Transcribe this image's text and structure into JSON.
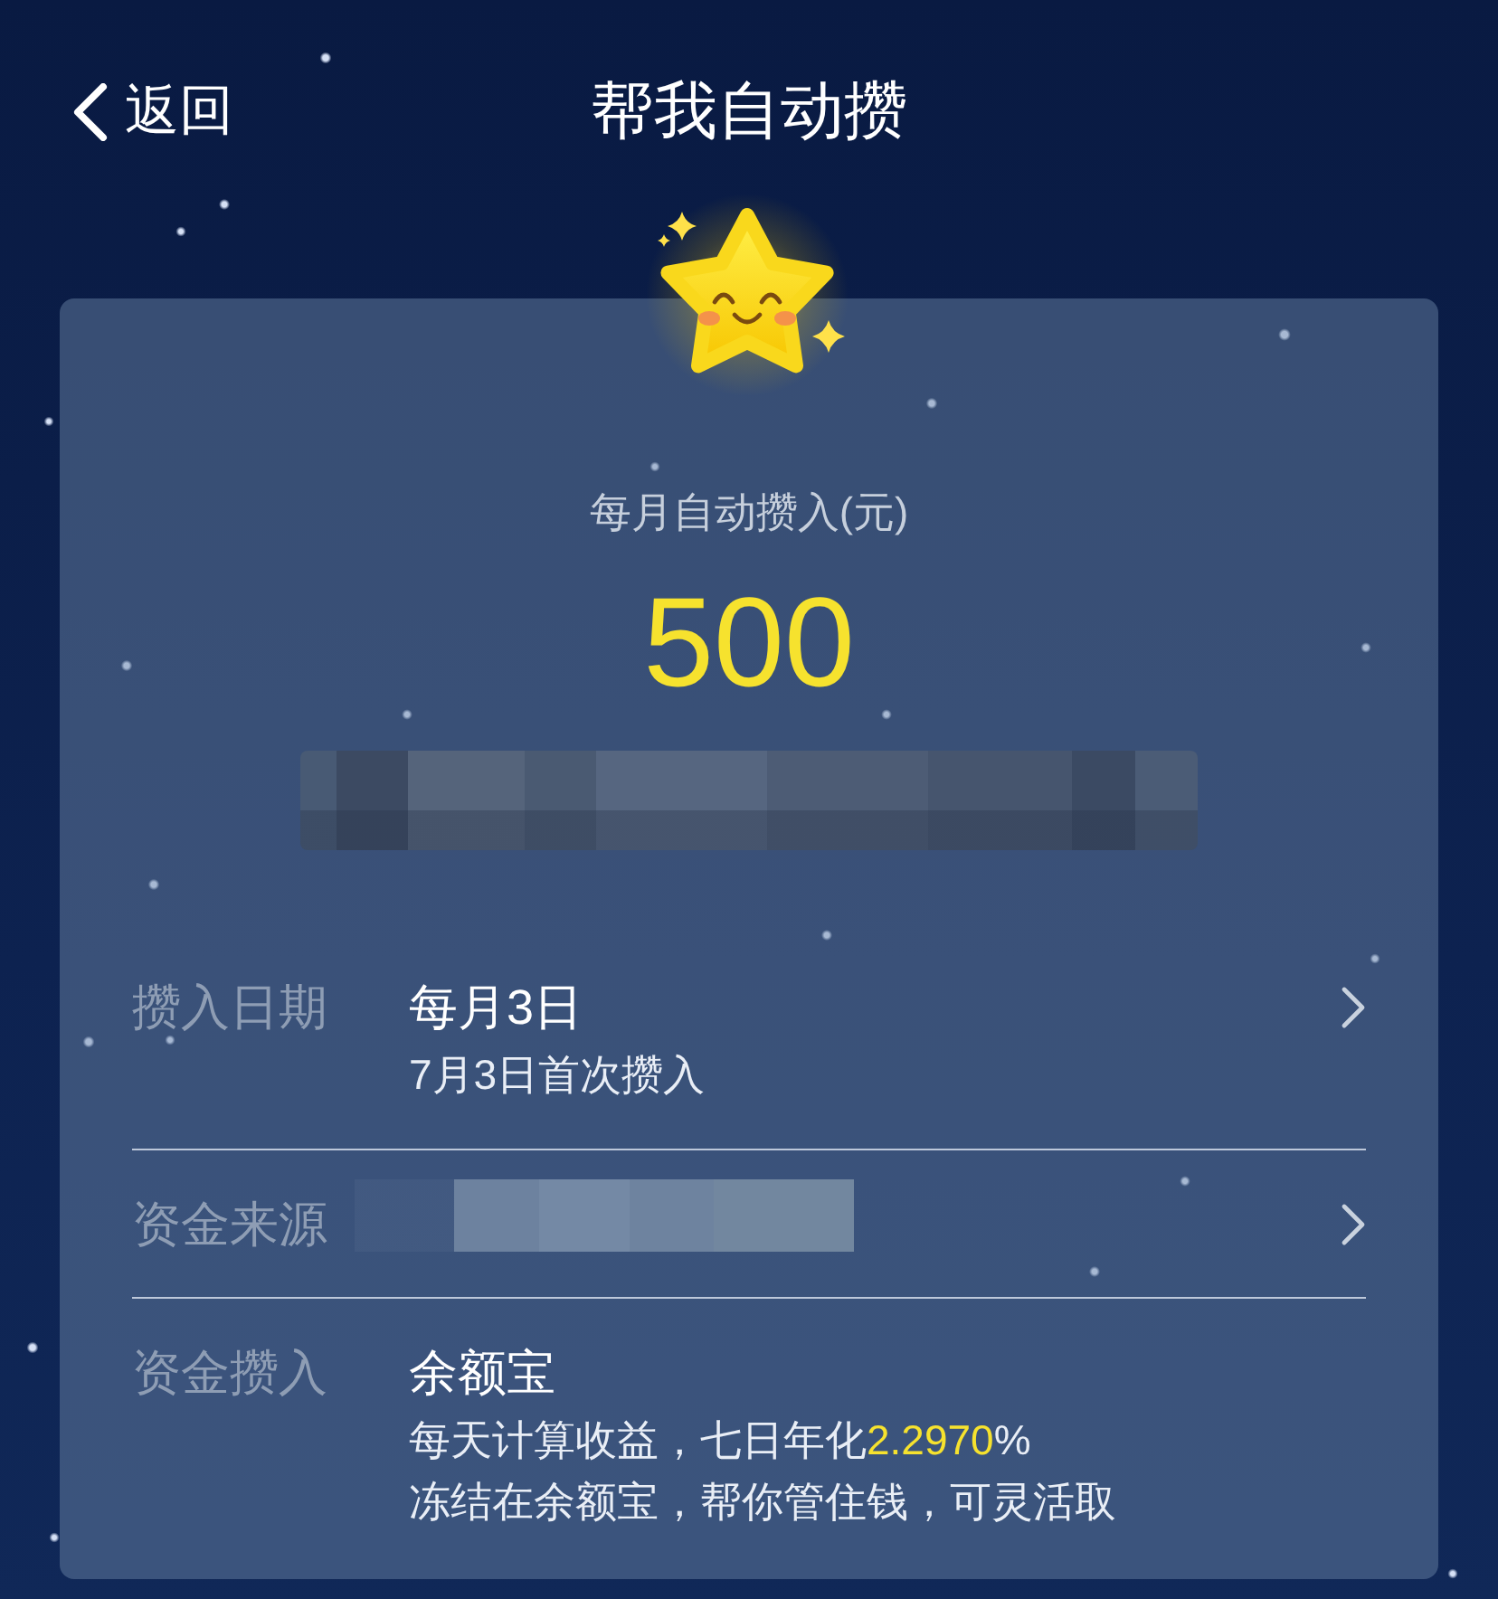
{
  "nav": {
    "back_label": "返回",
    "title": "帮我自动攒"
  },
  "summary": {
    "caption": "每月自动攒入(元)",
    "amount": "500",
    "redacted": true
  },
  "rows": [
    {
      "label": "攒入日期",
      "value": "每月3日",
      "redacted": false,
      "arrow": true,
      "notes": [
        [
          {
            "text": "7月3日首次攒入",
            "highlight": false
          }
        ]
      ]
    },
    {
      "label": "资金来源",
      "redacted": true,
      "arrow": true
    },
    {
      "label": "资金攒入",
      "value": "余额宝",
      "redacted": false,
      "arrow": false,
      "notes": [
        [
          {
            "text": "每天计算收益，七日年化",
            "highlight": false
          },
          {
            "text": "2.2970",
            "highlight": true
          },
          {
            "text": "%",
            "highlight": false
          }
        ],
        [
          {
            "text": "冻结在余额宝，帮你管住钱，可灵活取",
            "highlight": false
          }
        ]
      ]
    }
  ]
}
